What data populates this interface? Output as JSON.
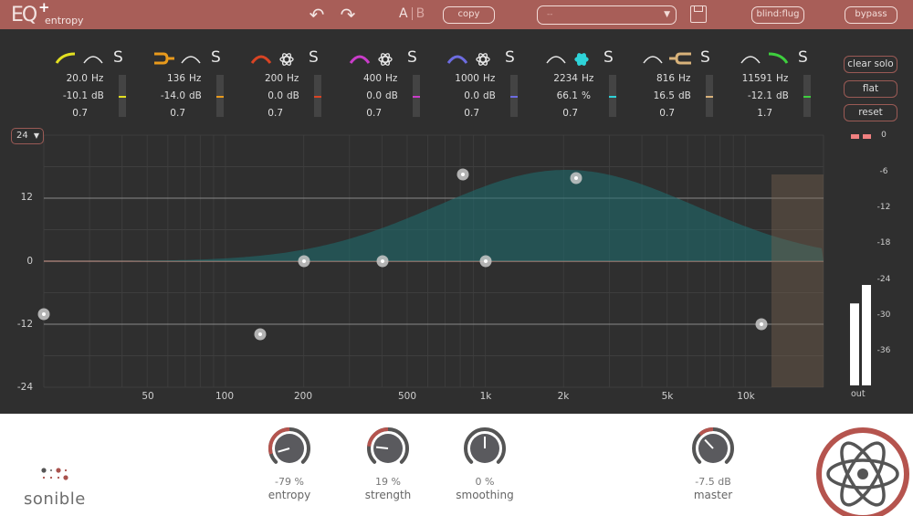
{
  "header": {
    "app_name": "entropy",
    "logo_letters": "EQ",
    "logo_plus": "+",
    "undo_icon": "↶",
    "redo_icon": "↷",
    "ab_a": "A",
    "ab_b": "B",
    "copy_label": "copy",
    "preset_value": "--",
    "preset_caret": "▼",
    "blind_label": "blind:flug",
    "bypass_label": "bypass"
  },
  "bands": [
    {
      "color": "#e3e021",
      "filter": "low-shelf",
      "mode": "bell-outline",
      "freq": "20.0",
      "freq_unit": "Hz",
      "gain": "-10.1",
      "gain_unit": "dB",
      "q": "0.7",
      "solo": "S",
      "meter": 0.5
    },
    {
      "color": "#e89a1c",
      "filter": "notch",
      "mode": "bell-outline",
      "freq": "136",
      "freq_unit": "Hz",
      "gain": "-14.0",
      "gain_unit": "dB",
      "q": "0.7",
      "solo": "S",
      "meter": 0.5
    },
    {
      "color": "#d84424",
      "filter": "bell",
      "mode": "atom",
      "freq": "200",
      "freq_unit": "Hz",
      "gain": "0.0",
      "gain_unit": "dB",
      "q": "0.7",
      "solo": "S",
      "meter": 0.5
    },
    {
      "color": "#c93cc9",
      "filter": "bell",
      "mode": "atom",
      "freq": "400",
      "freq_unit": "Hz",
      "gain": "0.0",
      "gain_unit": "dB",
      "q": "0.7",
      "solo": "S",
      "meter": 0.5
    },
    {
      "color": "#6d6ce0",
      "filter": "bell",
      "mode": "atom",
      "freq": "1000",
      "freq_unit": "Hz",
      "gain": "0.0",
      "gain_unit": "dB",
      "q": "0.7",
      "solo": "S",
      "meter": 0.5
    },
    {
      "color": "#2fd3d8",
      "filter": "bell-outline",
      "mode": "atom-active",
      "freq": "2234",
      "freq_unit": "Hz",
      "gain": "66.1",
      "gain_unit": "%",
      "q": "0.7",
      "solo": "S",
      "meter": 0.5
    },
    {
      "color": "#d8b27a",
      "filter": "bell-outline",
      "mode": "notch-reverse",
      "freq": "816",
      "freq_unit": "Hz",
      "gain": "16.5",
      "gain_unit": "dB",
      "q": "0.7",
      "solo": "S",
      "meter": 0.5
    },
    {
      "color": "#3ecf3e",
      "filter": "bell-outline",
      "mode": "high-shelf",
      "freq": "11591",
      "freq_unit": "Hz",
      "gain": "-12.1",
      "gain_unit": "dB",
      "q": "1.7",
      "solo": "S",
      "meter": 0.5
    }
  ],
  "side_buttons": {
    "clear_solo": "clear solo",
    "flat": "flat",
    "reset": "reset"
  },
  "range": {
    "value": "24",
    "caret": "▼"
  },
  "graph": {
    "y_labels": [
      "12",
      "0",
      "-12",
      "-24"
    ],
    "x_labels": [
      "50",
      "100",
      "200",
      "500",
      "1k",
      "2k",
      "5k",
      "10k"
    ]
  },
  "meter": {
    "labels": [
      "0",
      "-6",
      "-12",
      "-18",
      "-24",
      "-30",
      "-36"
    ],
    "out_label": "out",
    "left_level_db": -27,
    "right_level_db": -24,
    "clip_color": "#f08080"
  },
  "footer": {
    "brand": "sonible",
    "knobs": [
      {
        "name": "entropy",
        "value": "-79 %",
        "fraction": 0.105
      },
      {
        "name": "strength",
        "value": "19 %",
        "fraction": 0.19
      },
      {
        "name": "smoothing",
        "value": "0 %",
        "fraction": 0.5
      },
      {
        "name": "master",
        "value": "-7.5 dB",
        "fraction": 0.34
      }
    ]
  },
  "colors": {
    "accent": "#a85e58",
    "background": "#2f2f2f",
    "footer": "#ffffff"
  }
}
